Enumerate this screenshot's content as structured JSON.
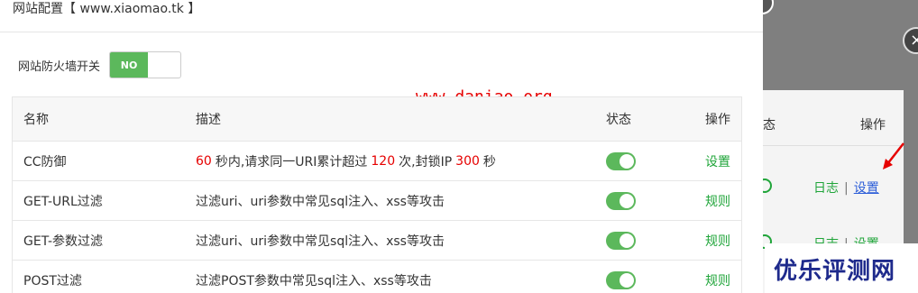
{
  "dialog": {
    "title": "网站配置【 www.xiaomao.tk 】",
    "switch_label": "网站防火墙开关",
    "switch_state": "NO"
  },
  "watermark": "www.daniao.org",
  "table": {
    "headers": {
      "name": "名称",
      "desc": "描述",
      "status": "状态",
      "op": "操作"
    },
    "rows": [
      {
        "name": "CC防御",
        "desc_parts": [
          "60",
          "秒内,请求同一URI累计超过",
          "120",
          "次,封锁IP",
          "300",
          "秒"
        ],
        "op": "设置",
        "enabled": true
      },
      {
        "name": "GET-URL过滤",
        "desc": "过滤uri、uri参数中常见sql注入、xss等攻击",
        "op": "规则",
        "enabled": true
      },
      {
        "name": "GET-参数过滤",
        "desc": "过滤uri、uri参数中常见sql注入、xss等攻击",
        "op": "规则",
        "enabled": true
      },
      {
        "name": "POST过滤",
        "desc": "过滤POST参数中常见sql注入、xss等攻击",
        "op": "规则",
        "enabled": true
      }
    ]
  },
  "background": {
    "status_header": "态",
    "op_header": "操作",
    "rows": [
      {
        "log": "日志",
        "sep": "|",
        "cfg": "设置"
      },
      {
        "log": "日志",
        "sep": "|",
        "cfg": "设置"
      }
    ],
    "close_glyph": "×"
  },
  "corner_watermark": "优乐评测网",
  "colors": {
    "green": "#20a53a",
    "switch_green": "#5cb85c",
    "red": "#e60000"
  }
}
